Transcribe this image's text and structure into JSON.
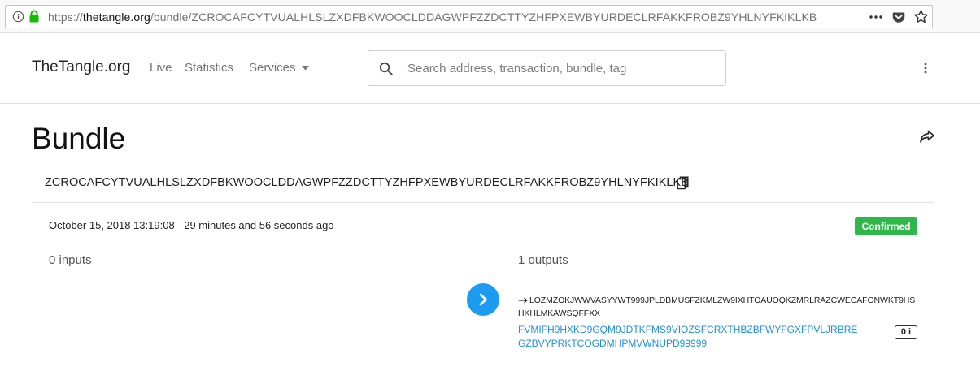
{
  "browser": {
    "url_scheme": "https://",
    "url_host": "thetangle.org",
    "url_path": "/bundle/ZCROCAFCYTVUALHLSLZXDFBKWOOCLDDAGWPFZZDCTTYZHFPXEWBYURDECLRFAKKFROBZ9YHLNYFKIKLKB"
  },
  "header": {
    "brand": "TheTangle.org",
    "nav": {
      "live": "Live",
      "statistics": "Statistics",
      "services": "Services"
    },
    "search_placeholder": "Search address, transaction, bundle, tag"
  },
  "bundle": {
    "title": "Bundle",
    "hash": "ZCROCAFCYTVUALHLSLZXDFBKWOOCLDDAGWPFZZDCTTYZHFPXEWBYURDECLRFAKKFROBZ9YHLNYFKIKLKB",
    "timestamp": "October 15, 2018 13:19:08 - 29 minutes and 56 seconds ago",
    "status": "Confirmed",
    "inputs_label": "0 inputs",
    "outputs_label": "1 outputs",
    "outputs": [
      {
        "address": "LOZMZOKJWWVASYYWT999JPLDBMUSFZKMLZW9IXHTOAUOQKZMRLRAZCWECAFONWKT9HSHKHLMKAWSQFFXX",
        "transaction": "FVMIFH9HXKD9GQM9JDTKFMS9VIOZSFCRXTHBZBFWYFGXFPVLJRBREGZBVYPRKTCOGDMHPMVWNUPD99999",
        "value": "0 i"
      }
    ]
  },
  "colors": {
    "confirmed": "#2fb84a",
    "link": "#1e8fe0",
    "accent": "#1d9bf0"
  },
  "icons": [
    "info-icon",
    "lock-icon",
    "more-horizontal-icon",
    "pocket-icon",
    "star-icon",
    "caret-down-icon",
    "search-icon",
    "more-vertical-icon",
    "share-icon",
    "copy-icon",
    "chevron-right-icon",
    "arrow-right-icon"
  ]
}
